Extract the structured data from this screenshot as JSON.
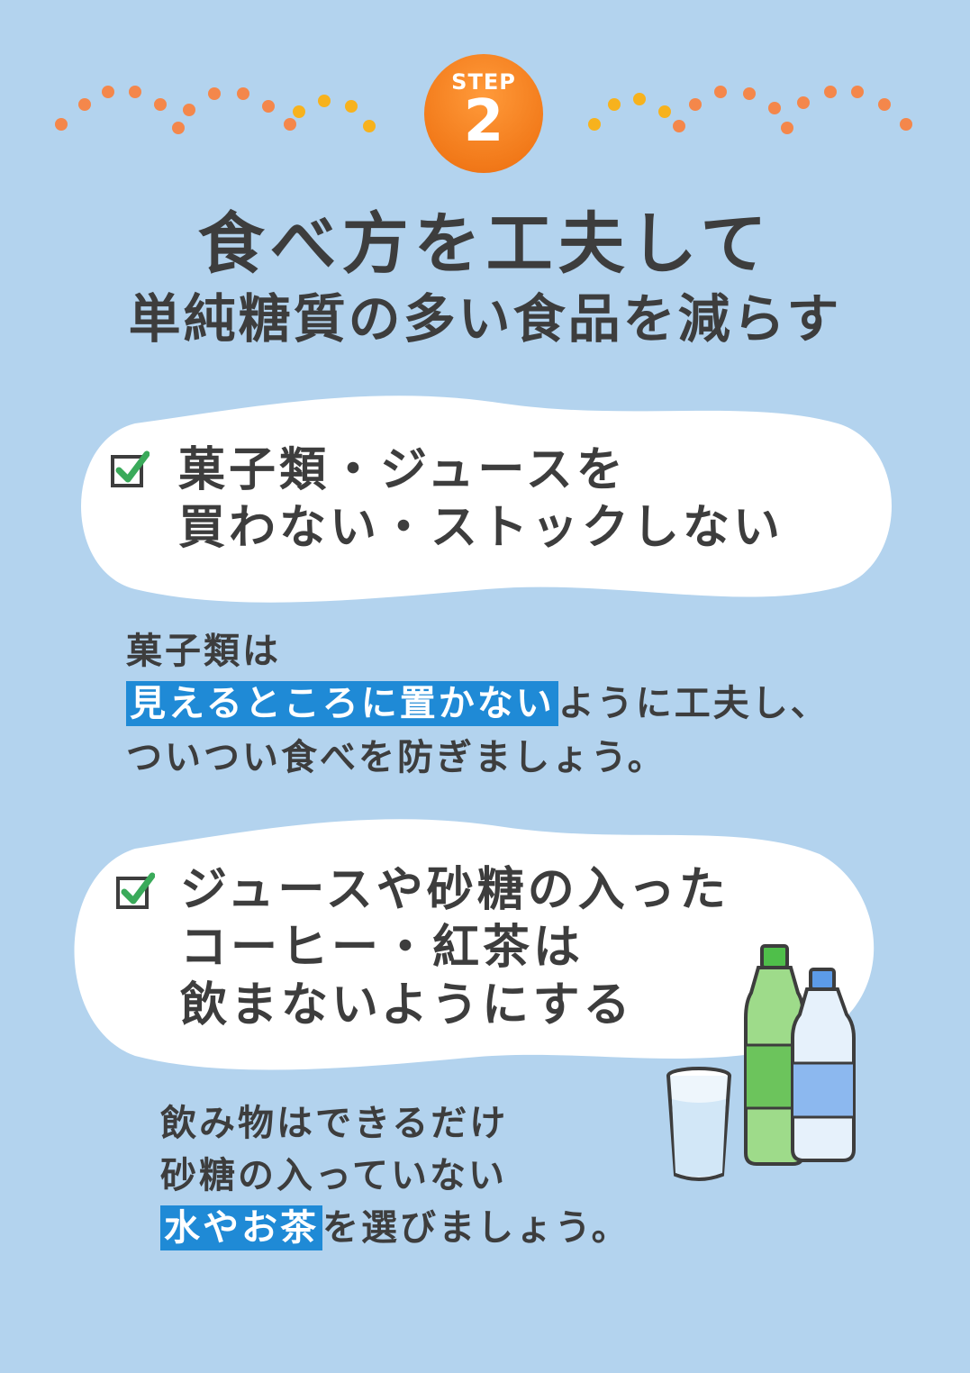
{
  "step": {
    "label": "STEP",
    "number": "2"
  },
  "title": {
    "line1": "食べ方を工夫して",
    "line2": "単純糖質の多い食品を減らす"
  },
  "items": [
    {
      "icon": "checkbox-checked-icon",
      "lines": [
        "菓子類・ジュースを",
        "買わない・ストックしない"
      ],
      "desc": {
        "line1": "菓子類は",
        "highlight": "見えるところに置かない",
        "after_highlight": "ように工夫し、",
        "line3": "ついつい食べを防ぎましょう。"
      }
    },
    {
      "icon": "checkbox-checked-icon",
      "lines": [
        "ジュースや砂糖の入った",
        "コーヒー・紅茶は",
        "飲まないようにする"
      ],
      "desc": {
        "line1": "飲み物はできるだけ",
        "line2": "砂糖の入っていない",
        "highlight": "水やお茶",
        "after_highlight": "を選びましょう。"
      }
    }
  ],
  "colors": {
    "background": "#b3d3ee",
    "accent_orange": "#f27a1a",
    "highlight_blue": "#1f8ad6",
    "check_green": "#3aaa5a"
  },
  "illustrations": [
    "glass-of-water",
    "green-tea-bottle",
    "water-bottle"
  ]
}
